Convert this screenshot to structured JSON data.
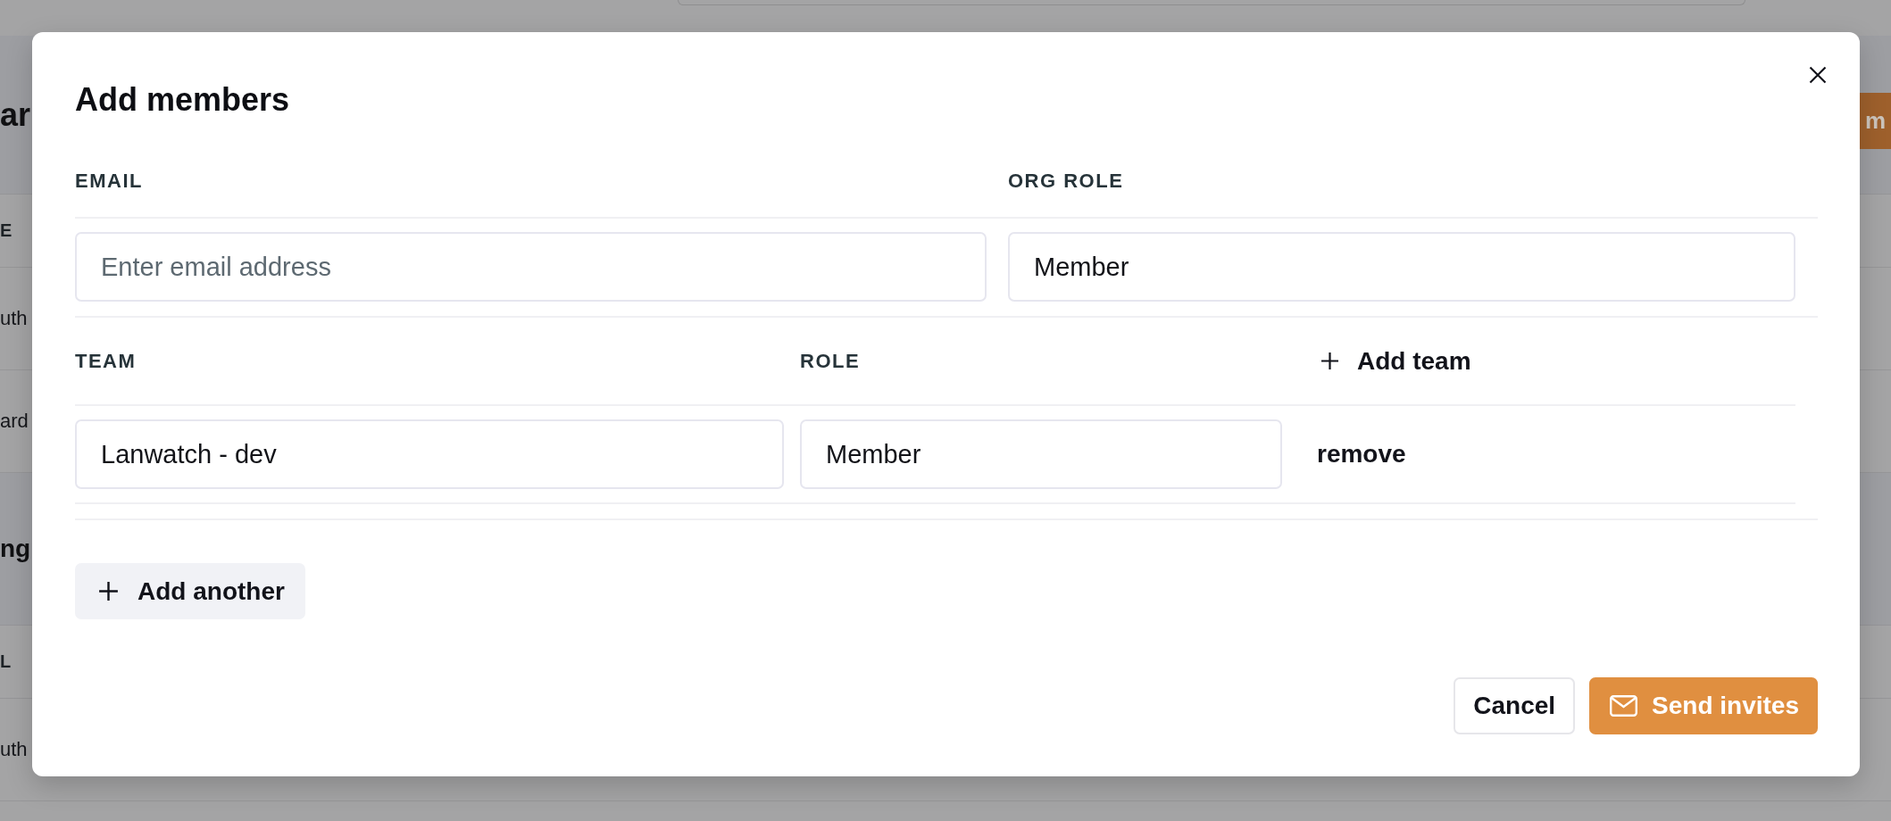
{
  "background_page": {
    "title": "ar",
    "action_button": "m",
    "tables": [
      {
        "header": "E",
        "rows": [
          "uth",
          "ard"
        ]
      },
      {
        "heading": "ng",
        "header": "L",
        "rows": [
          "uth"
        ]
      }
    ]
  },
  "dialog": {
    "title": "Add members",
    "columns": [
      {
        "label": "EMAIL"
      },
      {
        "label": "ORG ROLE"
      }
    ],
    "members": [
      {
        "email": {
          "placeholder": "Enter email address"
        },
        "org_role": {
          "value": "Member"
        },
        "team_columns": [
          {
            "label": "TEAM"
          },
          {
            "label": "ROLE"
          }
        ],
        "add_team": "Add team",
        "teams": [
          {
            "team": "Lanwatch - dev",
            "role": "Member",
            "remove": "remove"
          }
        ]
      }
    ],
    "add_another": "Add another",
    "buttons": [
      {
        "kind": "secondary",
        "label": "Cancel"
      },
      {
        "kind": "primary",
        "label": "Send invites"
      }
    ]
  }
}
